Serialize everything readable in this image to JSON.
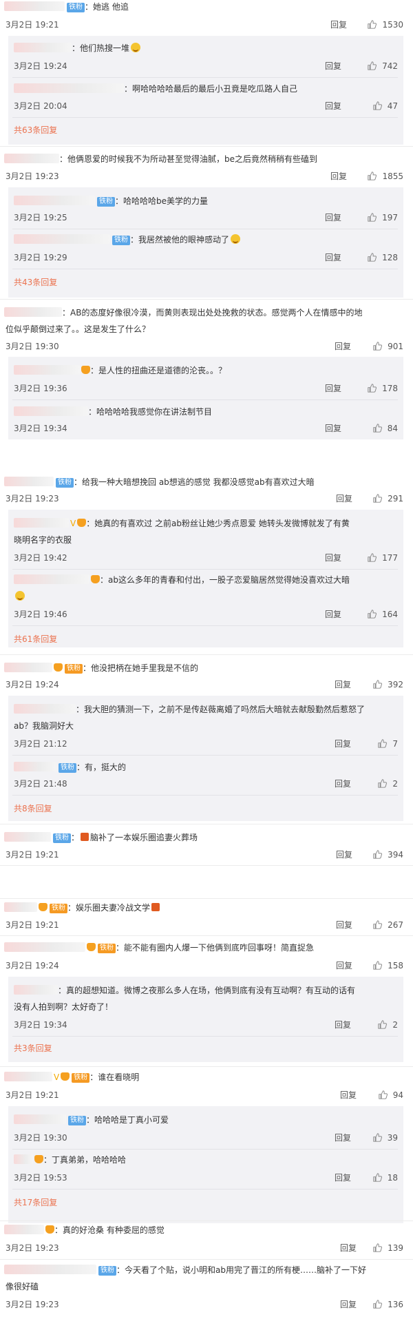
{
  "labels": {
    "reply": "回复"
  },
  "s1": {
    "c1": {
      "text": "：她逃 他追",
      "date": "3月2日 19:21",
      "likes": "1530",
      "badge": "铁粉",
      "user_tail": "上"
    },
    "r1": {
      "text": "：他们热搜一堆",
      "date": "3月2日 19:24",
      "likes": "742",
      "user_tail": "上"
    },
    "r2": {
      "text": "：啊哈哈哈哈最后的最后小丑竟是吃瓜路人自己",
      "date": "3月2日 20:04",
      "likes": "47",
      "user_tail": "子"
    },
    "more1": "共63条回复",
    "c2": {
      "text": "：他俩恩爱的时候我不为所动甚至觉得油腻，be之后竟然稍稍有些磕到",
      "date": "3月2日 19:23",
      "likes": "1855"
    },
    "r3": {
      "text": "：哈哈哈哈be美学的力量",
      "date": "3月2日 19:25",
      "likes": "197",
      "badge": "铁粉"
    },
    "r4": {
      "text": "：我居然被他的眼神感动了",
      "date": "3月2日 19:29",
      "likes": "128",
      "badge": "铁粉"
    },
    "more2": "共43条回复",
    "c3": {
      "line1": "：AB的态度好像很冷漠，而黄则表现出处处挽救的状态。感觉两个人在情感中的地",
      "line2": "位似乎颠倒过来了。。这是发生了什么？",
      "date": "3月2日 19:30",
      "likes": "901"
    },
    "r5": {
      "text": "：是人性的扭曲还是道德的沦丧。。？",
      "date": "3月2日 19:36",
      "likes": "178"
    },
    "r6": {
      "text": "：哈哈哈哈我感觉你在讲法制节目",
      "date": "3月2日 19:34",
      "likes": "84"
    }
  },
  "s2": {
    "c1": {
      "text": "：给我一种大暗想挽回 ab想逃的感觉 我都没感觉ab有喜欢过大暗",
      "date": "3月2日 19:23",
      "likes": "291",
      "badge": "铁粉"
    },
    "r1": {
      "line1": "：她真的有喜欢过 之前ab粉丝让她少秀点恩爱 她转头发微博就发了有黄",
      "line2": "晓明名字的衣服",
      "date": "3月2日 19:42",
      "likes": "177",
      "user_tail": "能",
      "vip": "V"
    },
    "r2": {
      "text": "：ab这么多年的青春和付出，一股子恋爱脑居然觉得她没喜欢过大暗",
      "date": "3月2日 19:46",
      "likes": "164"
    },
    "more1": "共61条回复",
    "c2": {
      "text": "：他没把柄在她手里我是不信的",
      "date": "3月2日 19:24",
      "likes": "392",
      "badge": "铁粉"
    },
    "r3": {
      "line1": "：我大胆的猜测一下，之前不是传赵薇离婚了吗然后大暗就去献殷勤然后惹怒了",
      "line2": "ab？我脑洞好大",
      "date": "3月2日 21:12",
      "likes": "7"
    },
    "r4": {
      "text": "：有，挺大的",
      "date": "3月2日 21:48",
      "likes": "2",
      "badge": "铁粉"
    },
    "more2": "共8条回复",
    "c3": {
      "text": "脑补了一本娱乐圈追妻火葬场",
      "date": "3月2日 19:21",
      "likes": "394",
      "badge": "铁粉"
    }
  },
  "s3": {
    "c1": {
      "text": "：娱乐圈夫妻冷战文学",
      "date": "3月2日 19:21",
      "likes": "267",
      "badge": "铁粉"
    },
    "c2": {
      "text": "：能不能有圈内人爆一下他俩到底咋回事呀！简直捉急",
      "date": "3月2日 19:24",
      "likes": "158",
      "badge": "铁粉"
    },
    "r1": {
      "line1": "：真的超想知道。微博之夜那么多人在场，他俩到底有没有互动啊？有互动的话有",
      "line2": "没有人拍到啊？太好奇了！",
      "date": "3月2日 19:34",
      "likes": "2"
    },
    "more1": "共3条回复",
    "c3": {
      "text": "：谁在看晓明",
      "date": "3月2日 19:21",
      "likes": "94",
      "badge": "铁粉",
      "vip": "V"
    },
    "r2": {
      "text": "：哈哈哈是丁真小可爱",
      "date": "3月2日 19:30",
      "likes": "39",
      "badge": "铁粉"
    },
    "r3": {
      "text": "：丁真弟弟，哈哈哈哈",
      "date": "3月2日 19:53",
      "likes": "18"
    },
    "more2": "共17条回复",
    "c4": {
      "text": "：真的好沧桑 有种委屈的感觉",
      "date": "3月2日 19:23",
      "likes": "139"
    },
    "c5": {
      "line1": "：今天看了个贴，说小明和ab用完了晋江的所有梗……脑补了一下好",
      "line2": "像很好磕",
      "date": "3月2日 19:23",
      "likes": "136",
      "badge": "铁粉"
    }
  }
}
